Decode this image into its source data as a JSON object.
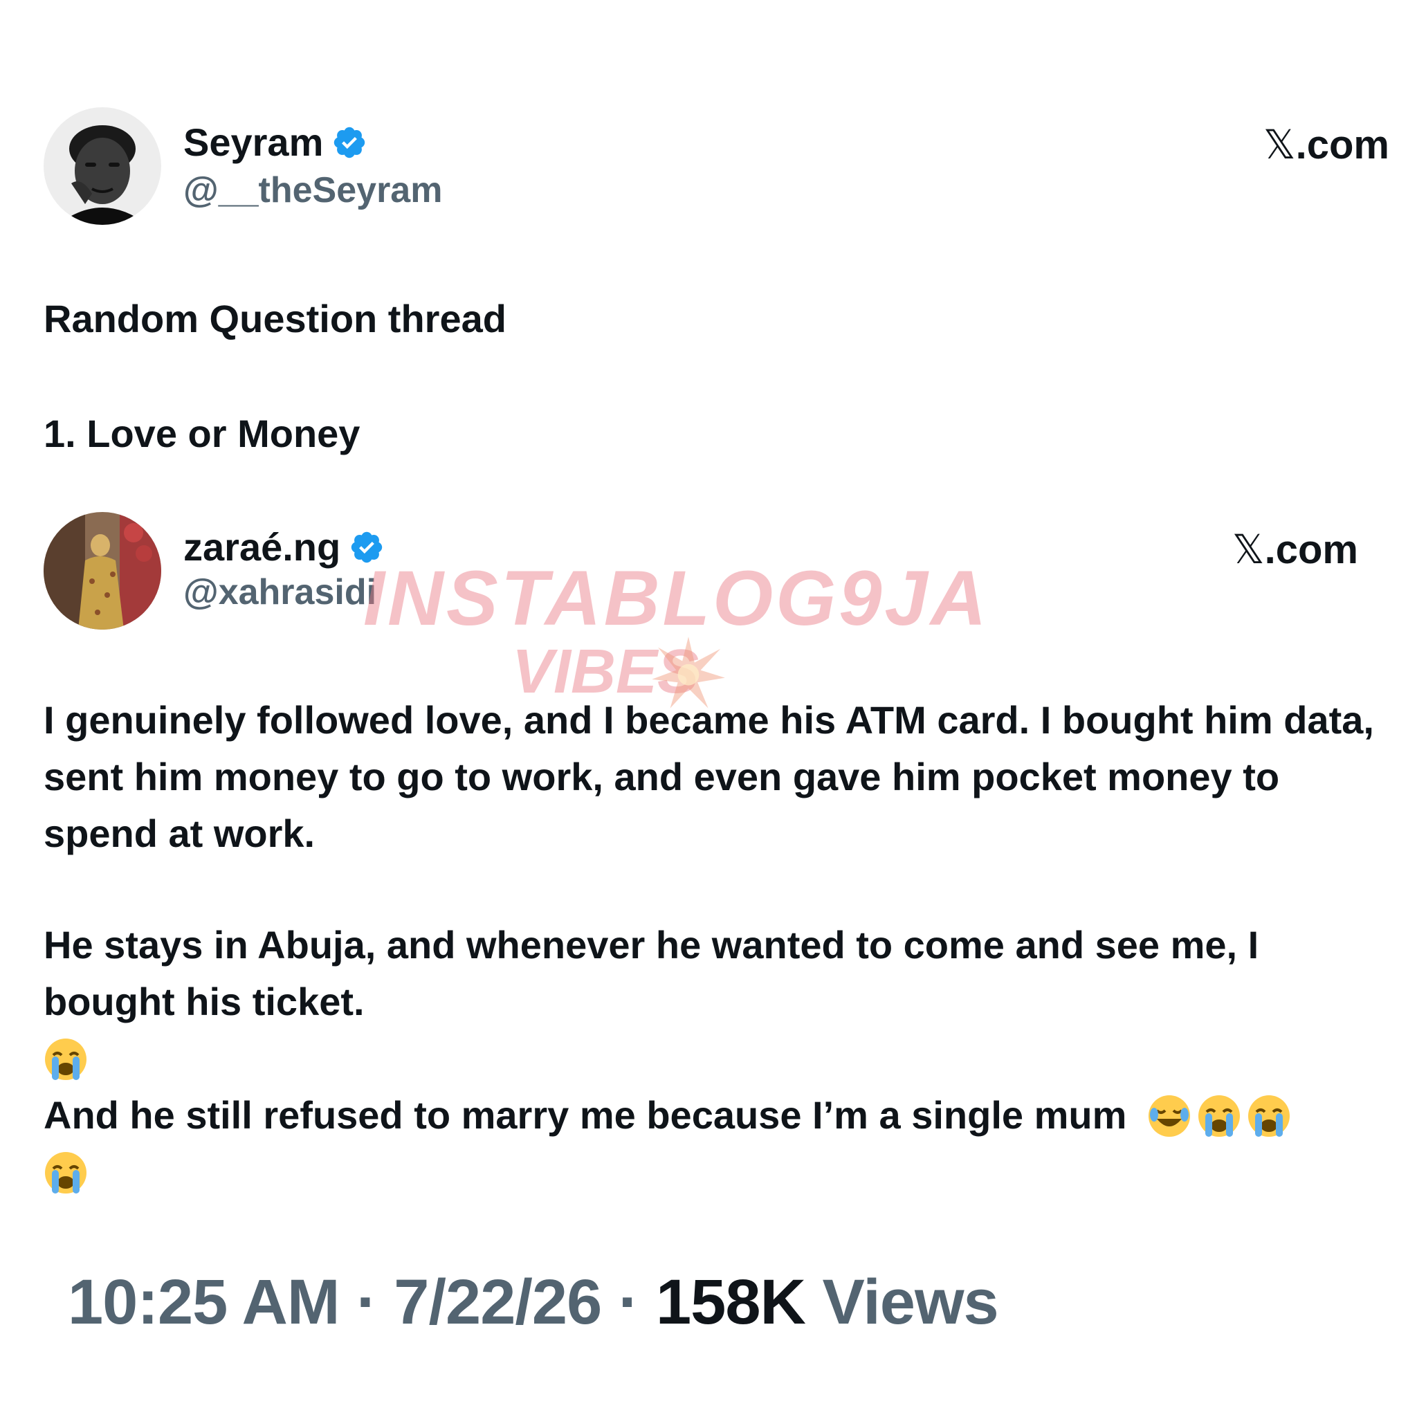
{
  "tweet1": {
    "author_name": "Seyram",
    "author_handle": "@__theSeyram",
    "brand": ".com",
    "title": "Random Question thread",
    "question": "1. Love or Money"
  },
  "tweet2": {
    "author_name": "zaraé.ng",
    "author_handle": "@xahrasidi",
    "brand": ".com",
    "paragraph1": "I genuinely followed love, and I became his ATM card. I bought him data, sent him money to go to work, and even gave him pocket money to spend at work.",
    "paragraph2": "He stays in Abuja, and whenever he wanted to come and see me, I bought his ticket.",
    "paragraph3": "And he still refused to marry me because I’m a single mum"
  },
  "footer": {
    "time": "10:25 AM",
    "separator": " · ",
    "date": "7/22/26",
    "views_count": "158K",
    "views_label": " Views"
  },
  "watermark": {
    "line1": "INSTABLOG9JA",
    "line2": "VIBES"
  },
  "icons": {
    "verified": "verified-badge-icon",
    "x_logo": "x-logo-icon",
    "crying": "loudly-crying-face-emoji",
    "laughing": "tears-of-joy-emoji",
    "burst": "collision-burst-icon"
  },
  "colors": {
    "text_primary": "#0f1419",
    "text_secondary": "#536471",
    "verified_blue": "#1d9bf0",
    "watermark_pink": "#e97882"
  }
}
